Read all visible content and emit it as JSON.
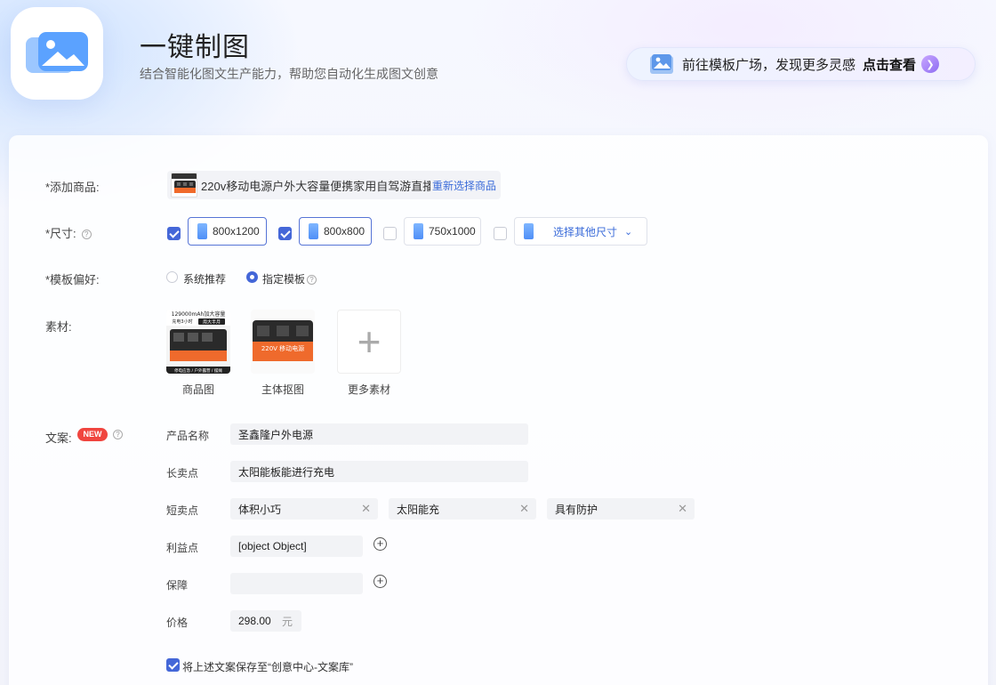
{
  "header": {
    "title": "一键制图",
    "subtitle": "结合智能化图文生产能力，帮助您自动化生成图文创意",
    "banner_text": "前往模板广场，发现更多灵感",
    "banner_link": "点击查看"
  },
  "form": {
    "product": {
      "label": "*添加商品:",
      "name": "220v移动电源户外大容量便携家用自驾游直播...",
      "relink": "重新选择商品"
    },
    "size": {
      "label": "*尺寸:",
      "options": [
        {
          "value": "800x1200",
          "checked": true
        },
        {
          "value": "800x800",
          "checked": true
        },
        {
          "value": "750x1000",
          "checked": false
        },
        {
          "value": "选择其他尺寸",
          "checked": false
        }
      ]
    },
    "template": {
      "label": "*模板偏好:",
      "options": [
        {
          "label": "系统推荐",
          "selected": false
        },
        {
          "label": "指定模板",
          "selected": true
        }
      ]
    },
    "materials": {
      "label": "素材:",
      "items": [
        {
          "caption": "商品图",
          "overlay_top": "129000mAh加大容量",
          "overlay_mid": "充电3小时",
          "overlay_badge": "用大半月",
          "overlay_bottom": "停电应急 / 户外露营 / 摆摊"
        },
        {
          "caption": "主体抠图",
          "overlay_text": "220V 移动电源"
        },
        {
          "caption": "更多素材"
        }
      ]
    },
    "copy": {
      "label": "文案:",
      "badge": "NEW",
      "fields": {
        "product_name": {
          "label": "产品名称",
          "value": "圣鑫隆户外电源"
        },
        "long_point": {
          "label": "长卖点",
          "value": "太阳能板能进行充电"
        },
        "short_points": {
          "label": "短卖点",
          "values": [
            "体积小巧",
            "太阳能充",
            "具有防护"
          ]
        },
        "benefit": {
          "label": "利益点",
          "value": "[object Object]"
        },
        "guarantee": {
          "label": "保障",
          "value": ""
        },
        "price": {
          "label": "价格",
          "value": "298.00",
          "unit": "元"
        }
      },
      "save_label": "将上述文案保存至“创意中心-文案库”",
      "save_checked": true
    }
  },
  "colors": {
    "accent": "#4467d8",
    "link": "#3a6bd9",
    "badge": "#f0453f"
  }
}
